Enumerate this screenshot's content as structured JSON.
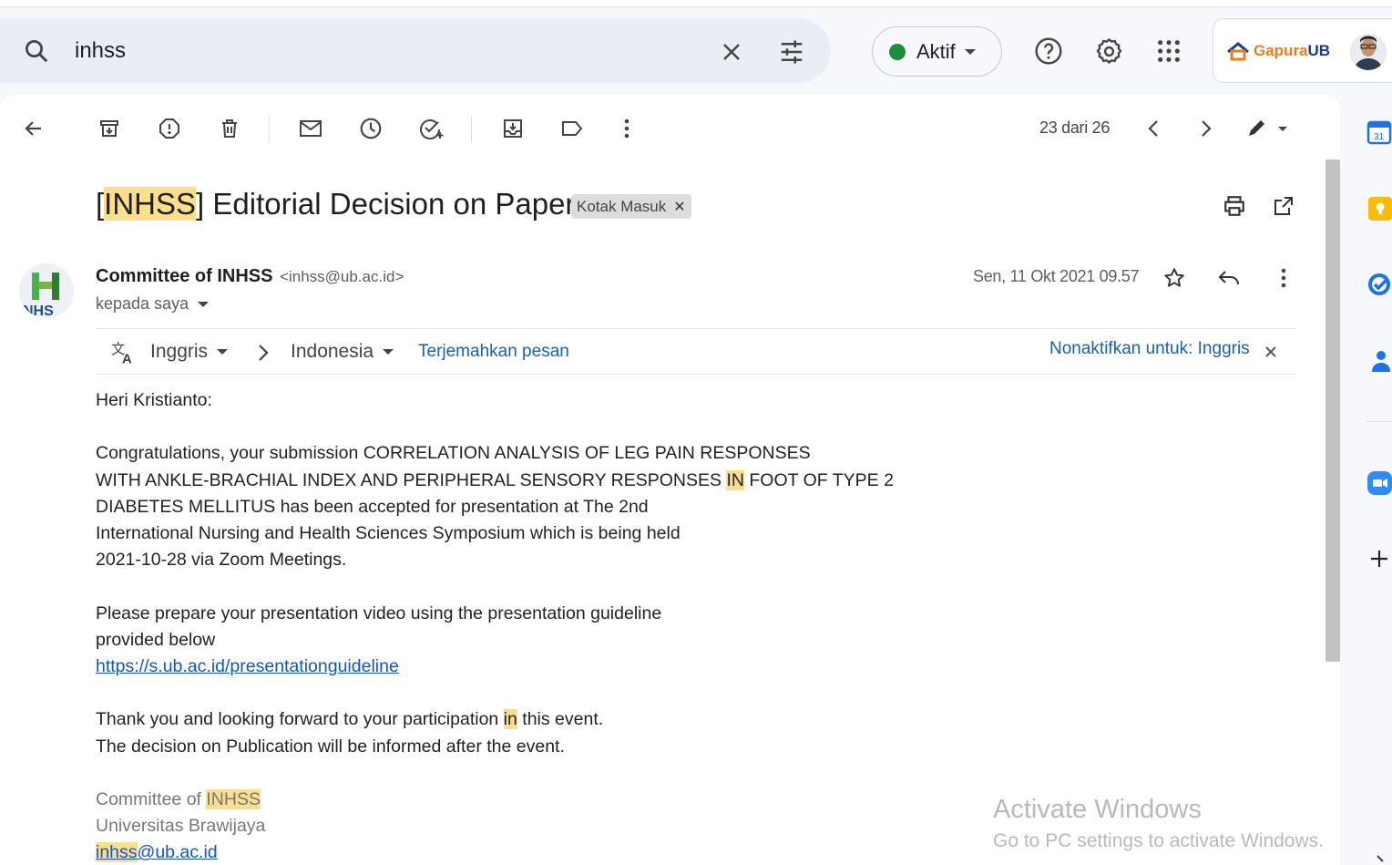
{
  "search": {
    "query": "inhss"
  },
  "status": {
    "label": "Aktif"
  },
  "account": {
    "brand_prefix": "Gapura",
    "brand_suffix": "UB"
  },
  "pager": {
    "text": "23 dari 26"
  },
  "message": {
    "subject_open": "[",
    "subject_highlight": "INHSS",
    "subject_rest": "] Editorial Decision on Paper",
    "label_chip": "Kotak Masuk",
    "sender_name": "Committee of INHSS",
    "sender_email": "<inhss@ub.ac.id>",
    "to": "kepada saya",
    "date": "Sen, 11 Okt 2021 09.57"
  },
  "translate": {
    "from_lang": "Inggris",
    "to_lang": "Indonesia",
    "translate_link": "Terjemahkan pesan",
    "disable_link": "Nonaktifkan untuk: Inggris"
  },
  "body": {
    "greeting": "Heri Kristianto:",
    "p1_l1": "Congratulations, your submission CORRELATION ANALYSIS OF LEG PAIN RESPONSES",
    "p1_l2_a": "WITH ANKLE-BRACHIAL INDEX AND PERIPHERAL SENSORY RESPONSES ",
    "p1_l2_hl": "IN",
    "p1_l2_b": " FOOT OF TYPE 2",
    "p1_l3": "DIABETES MELLITUS has been accepted for presentation at The 2nd",
    "p1_l4": "International Nursing and Health Sciences Symposium which is being held",
    "p1_l5": "2021-10-28 via Zoom Meetings.",
    "p2_l1": "Please prepare your presentation video using the presentation guideline",
    "p2_l2": "provided below",
    "p2_link": "https://s.ub.ac.id/presentationguideline",
    "p3_l1_a": "Thank you and looking forward to your participation ",
    "p3_l1_hl": "in",
    "p3_l1_b": " this event.",
    "p3_l2": "The decision on Publication will be informed after the event.",
    "sig_l1_a": "Committee of ",
    "sig_l1_hl": "INHSS",
    "sig_l2": "Universitas Brawijaya",
    "sig_email_hl": "inhss",
    "sig_email_rest": "@ub.ac.id"
  },
  "watermark": {
    "line1": "Activate Windows",
    "line2": "Go to PC settings to activate Windows."
  },
  "colors": {
    "accent_blue": "#1a5fb4",
    "highlight": "#fcdf8d",
    "status_green": "#1e8e3e"
  }
}
